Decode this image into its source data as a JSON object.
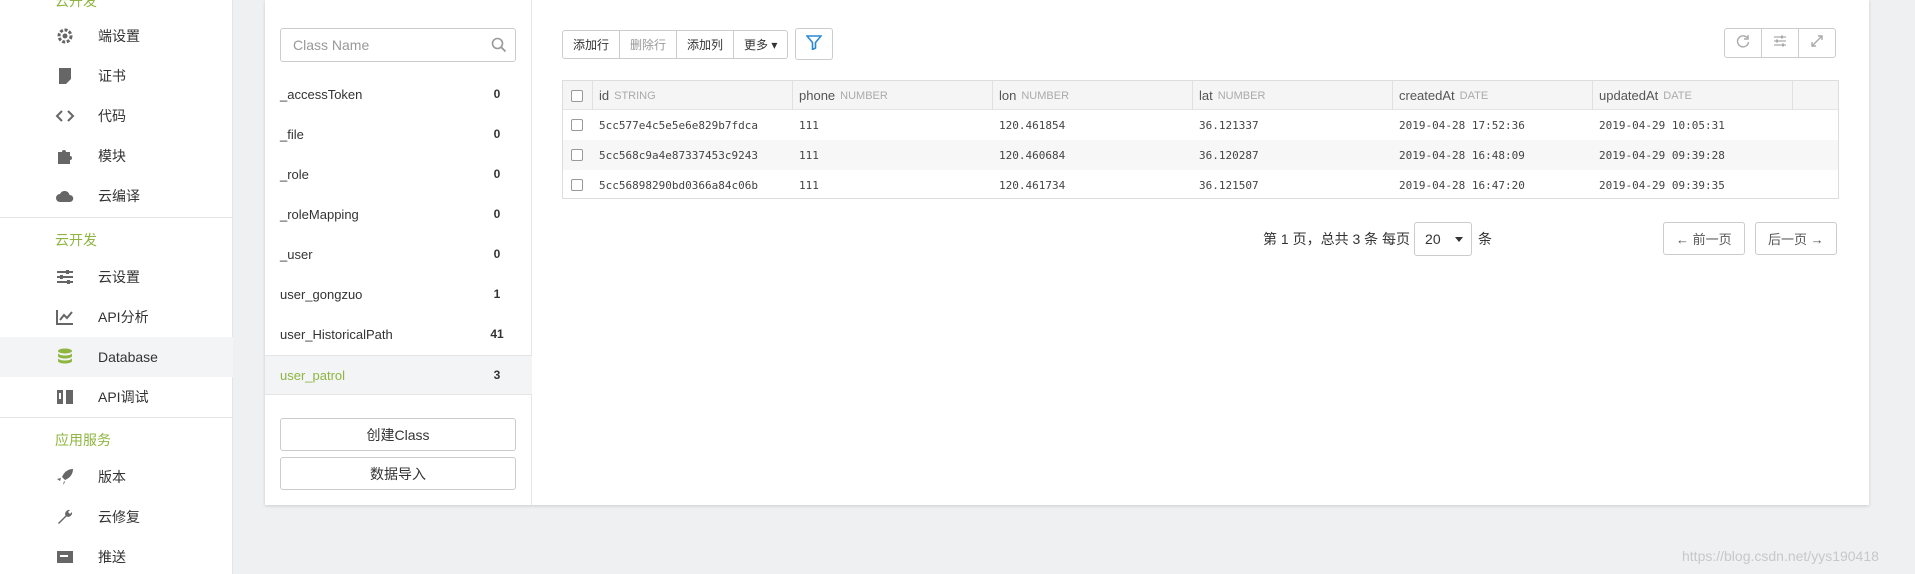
{
  "sidebar": {
    "top_section": "云开发",
    "items_a": [
      {
        "label": "端设置",
        "icon": "gear-icon"
      },
      {
        "label": "证书",
        "icon": "certificate-icon"
      },
      {
        "label": "代码",
        "icon": "code-icon"
      },
      {
        "label": "模块",
        "icon": "puzzle-icon"
      },
      {
        "label": "云编译",
        "icon": "cloud-icon"
      }
    ],
    "section_cloud": "云开发",
    "items_b": [
      {
        "label": "云设置",
        "icon": "sliders-icon"
      },
      {
        "label": "API分析",
        "icon": "chart-icon"
      },
      {
        "label": "Database",
        "icon": "database-icon"
      },
      {
        "label": "API调试",
        "icon": "debug-icon"
      }
    ],
    "section_services": "应用服务",
    "items_c": [
      {
        "label": "版本",
        "icon": "rocket-icon"
      },
      {
        "label": "云修复",
        "icon": "wrench-icon"
      },
      {
        "label": "推送",
        "icon": "push-icon"
      }
    ],
    "active_item": "Database"
  },
  "classes": {
    "search_placeholder": "Class Name",
    "list": [
      {
        "name": "_accessToken",
        "count": "0"
      },
      {
        "name": "_file",
        "count": "0"
      },
      {
        "name": "_role",
        "count": "0"
      },
      {
        "name": "_roleMapping",
        "count": "0"
      },
      {
        "name": "_user",
        "count": "0"
      },
      {
        "name": "user_gongzuo",
        "count": "1"
      },
      {
        "name": "user_HistoricalPath",
        "count": "41"
      },
      {
        "name": "user_patrol",
        "count": "3"
      }
    ],
    "active": "user_patrol",
    "create_label": "创建Class",
    "import_label": "数据导入"
  },
  "toolbar": {
    "add_row": "添加行",
    "delete_row": "删除行",
    "add_column": "添加列",
    "more": "更多"
  },
  "table": {
    "columns": [
      {
        "name": "id",
        "type": "STRING"
      },
      {
        "name": "phone",
        "type": "NUMBER"
      },
      {
        "name": "lon",
        "type": "NUMBER"
      },
      {
        "name": "lat",
        "type": "NUMBER"
      },
      {
        "name": "createdAt",
        "type": "DATE"
      },
      {
        "name": "updatedAt",
        "type": "DATE"
      }
    ],
    "rows": [
      [
        "5cc577e4c5e5e6e829b7fdca",
        "111",
        "120.461854",
        "36.121337",
        "2019-04-28 17:52:36",
        "2019-04-29 10:05:31"
      ],
      [
        "5cc568c9a4e87337453c9243",
        "111",
        "120.460684",
        "36.120287",
        "2019-04-28 16:48:09",
        "2019-04-29 09:39:28"
      ],
      [
        "5cc56898290bd0366a84c06b",
        "111",
        "120.461734",
        "36.121507",
        "2019-04-28 16:47:20",
        "2019-04-29 09:39:35"
      ]
    ]
  },
  "pagination": {
    "summary": "第 1 页，总共 3 条 每页",
    "page_size": "20",
    "unit": "条",
    "prev": "← 前一页",
    "next": "后一页 →"
  },
  "watermark": "https://blog.csdn.net/yys190418",
  "colors": {
    "accent": "#8fb541",
    "filter": "#2a87d6"
  }
}
